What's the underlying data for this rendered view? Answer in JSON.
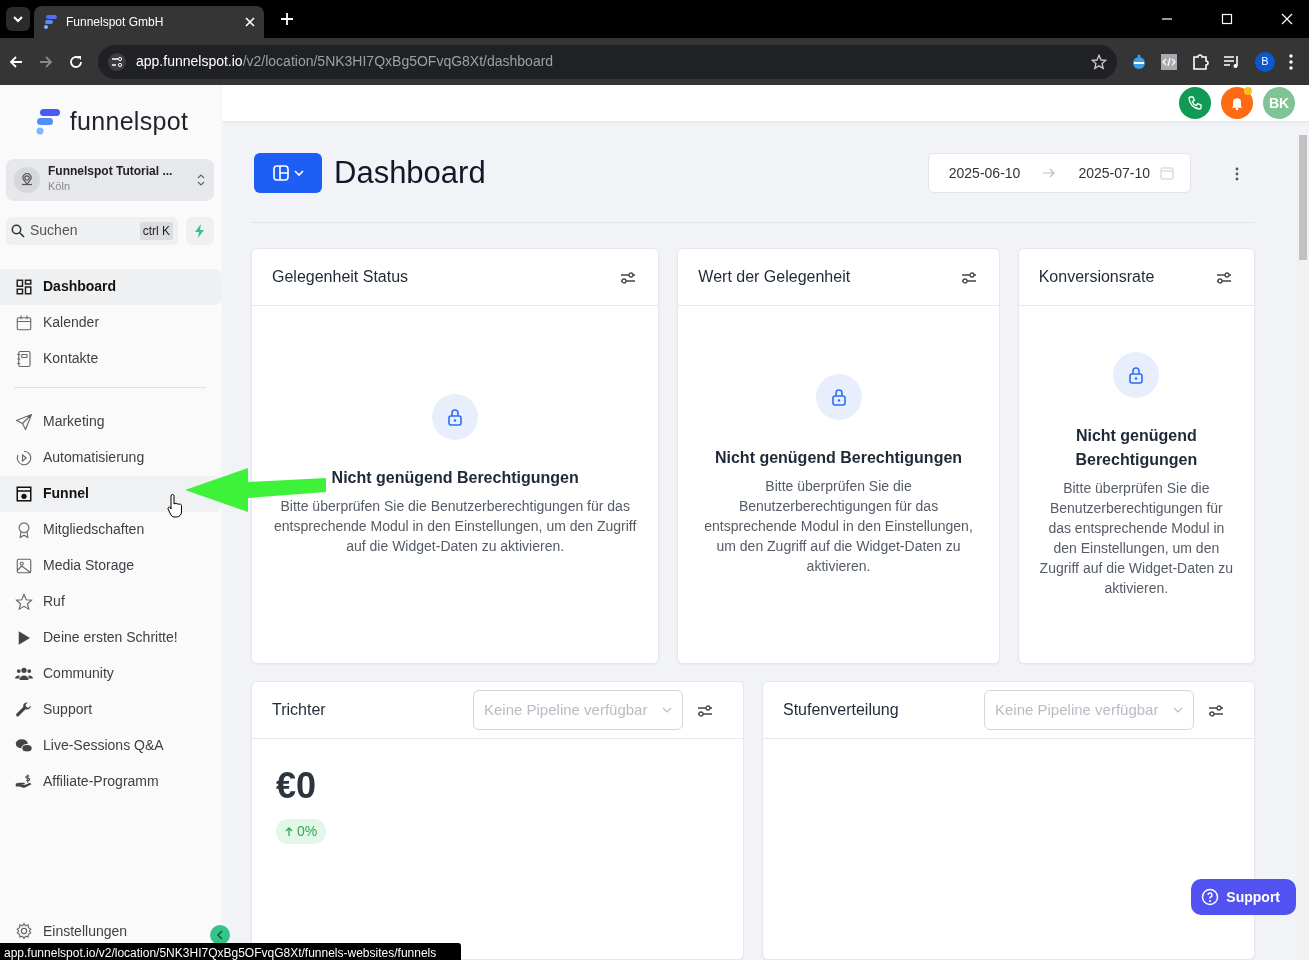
{
  "browser": {
    "tabs": [
      {
        "title": "Funnelspot GmbH",
        "selected": true
      }
    ],
    "url": {
      "host": "app.funnelspot.io",
      "path": "/v2/location/5NK3HI7QxBg5OFvqG8Xt/dashboard"
    },
    "profile_initial": "B",
    "status_url": "app.funnelspot.io/v2/location/5NK3HI7QxBg5OFvqG8Xt/funnels-websites/funnels"
  },
  "sidebar": {
    "brand": "funnelspot",
    "account": {
      "name": "Funnelspot Tutorial ...",
      "location": "Köln"
    },
    "search": {
      "placeholder": "Suchen",
      "shortcut": "ctrl K"
    },
    "groups": [
      [
        {
          "label": "Dashboard",
          "selected": true,
          "hovered": false
        },
        {
          "label": "Kalender",
          "selected": false,
          "hovered": false
        },
        {
          "label": "Kontakte",
          "selected": false,
          "hovered": false
        }
      ],
      [
        {
          "label": "Marketing",
          "selected": false,
          "hovered": false
        },
        {
          "label": "Automatisierung",
          "selected": false,
          "hovered": false
        },
        {
          "label": "Funnel",
          "selected": false,
          "hovered": true
        },
        {
          "label": "Mitgliedschaften",
          "selected": false,
          "hovered": false
        },
        {
          "label": "Media Storage",
          "selected": false,
          "hovered": false
        },
        {
          "label": "Ruf",
          "selected": false,
          "hovered": false
        },
        {
          "label": "Deine ersten Schritte!",
          "selected": false,
          "hovered": false
        },
        {
          "label": "Community",
          "selected": false,
          "hovered": false
        },
        {
          "label": "Support",
          "selected": false,
          "hovered": false
        },
        {
          "label": "Live-Sessions Q&A",
          "selected": false,
          "hovered": false
        },
        {
          "label": "Affiliate-Programm",
          "selected": false,
          "hovered": false
        }
      ]
    ],
    "footer_item": "Einstellungen"
  },
  "header": {
    "avatar_initials": "BK",
    "notifications_unread": true
  },
  "dashboard": {
    "title": "Dashboard",
    "date_range": {
      "start": "2025-06-10",
      "end": "2025-07-10"
    },
    "widgets": [
      {
        "kind": "locked",
        "title": "Gelegenheit Status",
        "heading": "Nicht genügend Berechtigungen",
        "message": "Bitte überprüfen Sie die Benutzerberechtigungen für das entsprechende Modul in den Einstellungen, um den Zugriff auf die Widget-Daten zu aktivieren."
      },
      {
        "kind": "locked",
        "title": "Wert der Gelegenheit",
        "heading": "Nicht genügend Berechtigungen",
        "message": "Bitte überprüfen Sie die Benutzerberechtigungen für das entsprechende Modul in den Einstellungen, um den Zugriff auf die Widget-Daten zu aktivieren."
      },
      {
        "kind": "locked",
        "title": "Konversionsrate",
        "heading": "Nicht genügend Berechtigungen",
        "message": "Bitte überprüfen Sie die Benutzerberechtigungen für das entsprechende Modul in den Einstellungen, um den Zugriff auf die Widget-Daten zu aktivieren."
      },
      {
        "kind": "pipeline",
        "title": "Trichter",
        "dropdown": {
          "placeholder": "Keine Pipeline verfügbar",
          "disabled": true
        },
        "value": "€0",
        "change": "0%"
      },
      {
        "kind": "pipeline",
        "title": "Stufenverteilung",
        "dropdown": {
          "placeholder": "Keine Pipeline verfügbar",
          "disabled": true
        }
      }
    ]
  },
  "support_button": "Support"
}
